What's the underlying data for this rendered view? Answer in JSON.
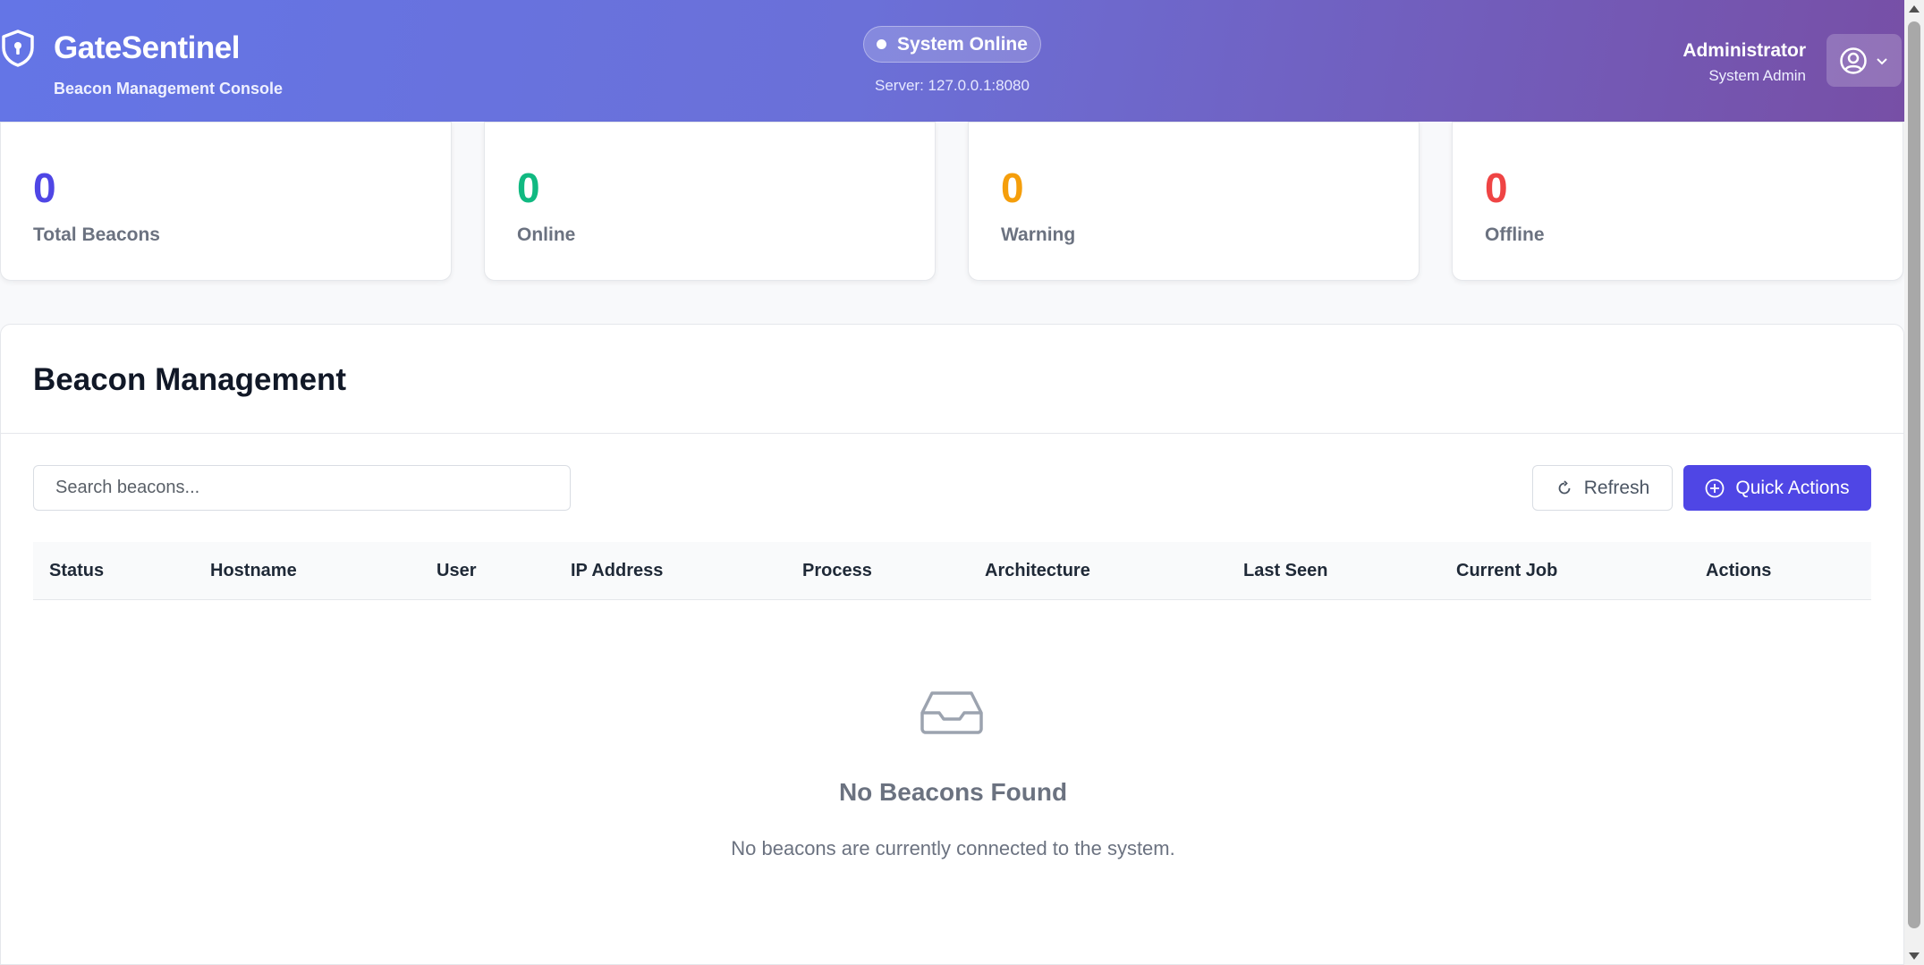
{
  "header": {
    "brand_title": "GateSentinel",
    "brand_subtitle": "Beacon Management Console",
    "status_text": "System Online",
    "server_text": "Server: 127.0.0.1:8080",
    "user_name": "Administrator",
    "user_role": "System Admin",
    "icons": [
      "shield-icon",
      "status-dot-icon",
      "user-circle-icon",
      "chevron-down-icon"
    ]
  },
  "stats": [
    {
      "value": "0",
      "label": "Total Beacons",
      "color": "#4f46e5"
    },
    {
      "value": "0",
      "label": "Online",
      "color": "#10b981"
    },
    {
      "value": "0",
      "label": "Warning",
      "color": "#f59e0b"
    },
    {
      "value": "0",
      "label": "Offline",
      "color": "#ef4444"
    }
  ],
  "panel": {
    "title": "Beacon Management",
    "search_placeholder": "Search beacons...",
    "refresh_label": "Refresh",
    "quick_actions_label": "Quick Actions",
    "columns": [
      "Status",
      "Hostname",
      "User",
      "IP Address",
      "Process",
      "Architecture",
      "Last Seen",
      "Current Job",
      "Actions"
    ],
    "rows": [],
    "empty_title": "No Beacons Found",
    "empty_text": "No beacons are currently connected to the system."
  },
  "colors": {
    "header_gradient_start": "#6475e6",
    "header_gradient_end": "#774fa6",
    "primary": "#4f46e5"
  }
}
